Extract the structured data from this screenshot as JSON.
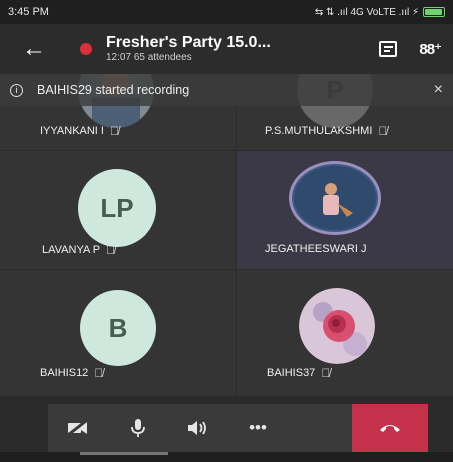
{
  "status_bar": {
    "time": "3:45 PM",
    "network": "⇆ ⇅ .ııl 4G VoLTE .ııl ⚡"
  },
  "header": {
    "back_icon": "arrow-left-icon",
    "title": "Fresher's Party 15.0...",
    "duration": "12:07",
    "attendees": "65 attendees",
    "recording_color": "#d9303b"
  },
  "banner": {
    "text": "BAIHIS29 started recording",
    "close": "×",
    "info": "i"
  },
  "participants": [
    {
      "name": "IYYANKANI I",
      "avatar": "photo",
      "muted": true
    },
    {
      "name": "P.S.MUTHULAKSHMI",
      "initials": "P",
      "avatar_color": "#6a6a6a",
      "muted": true
    },
    {
      "name": "LAVANYA P",
      "initials": "LP",
      "avatar_color": "#cfe8de",
      "muted": true
    },
    {
      "name": "JEGATHEESWARI J",
      "avatar": "photo",
      "muted": false,
      "active": true
    },
    {
      "name": "BAIHIS12",
      "initials": "B",
      "avatar_color": "#cfe8de",
      "muted": true
    },
    {
      "name": "BAIHIS37",
      "avatar": "photo-rose",
      "muted": true
    }
  ],
  "controls": {
    "video_off": "video-off-icon",
    "mic": "mic-icon",
    "speaker": "speaker-icon",
    "more": "•••",
    "hangup": "hang-up-icon",
    "hangup_color": "#c4314b"
  }
}
